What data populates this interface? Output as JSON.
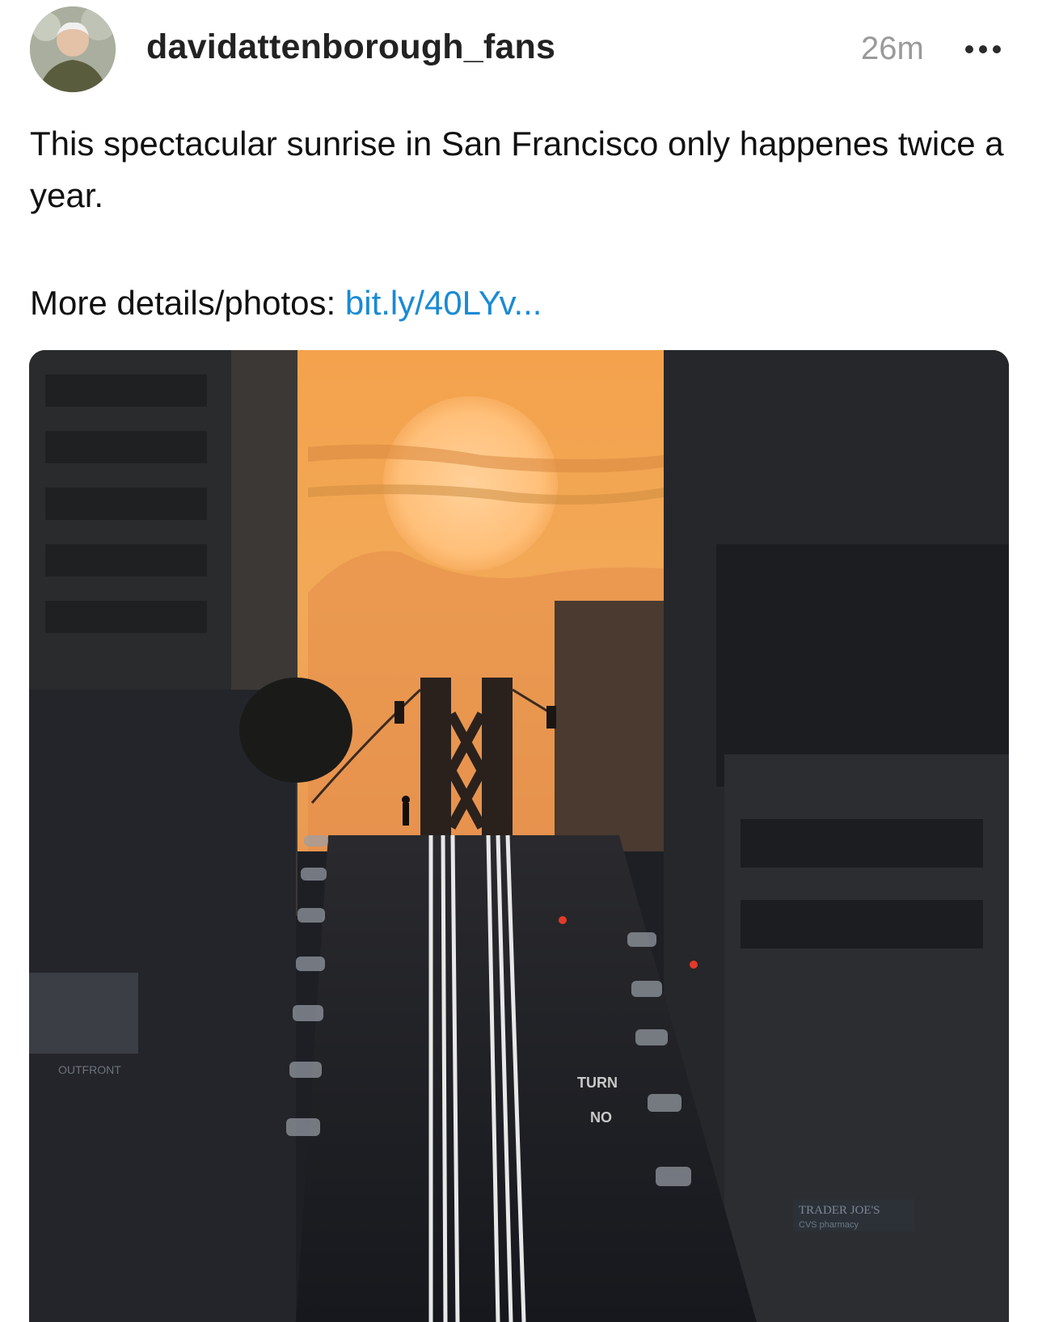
{
  "post": {
    "username": "davidattenborough_fans",
    "timestamp": "26m",
    "more_icon": "more-horizontal-icon",
    "caption_line1": "This spectacular sunrise in San Francisco only happenes twice a year.",
    "details_label": "More details/photos:",
    "details_link": "bit.ly/40LYv..."
  },
  "photo": {
    "sign_turn": "TURN",
    "sign_no": "NO",
    "billboard": "OUTFRONT",
    "store_sign": "TRADER JOE'S",
    "store_sub": "CVS pharmacy"
  },
  "colors": {
    "link": "#1a8ad4",
    "sky": "#f2a24a",
    "timestamp": "#9a9a9a"
  }
}
